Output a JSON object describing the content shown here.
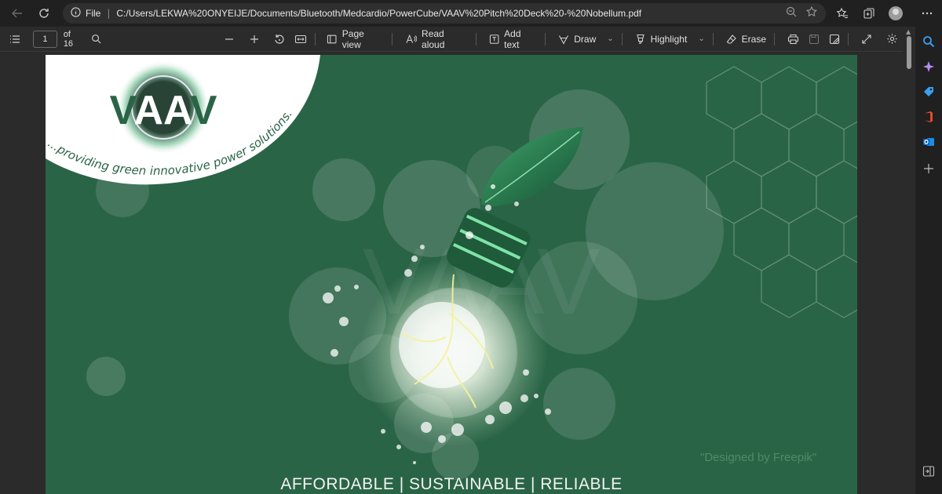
{
  "browser": {
    "file_label": "File",
    "url": "C:/Users/LEKWA%20ONYEIJE/Documents/Bluetooth/Medcardio/PowerCube/VAAV%20Pitch%20Deck%20-%20Nobellum.pdf"
  },
  "pdf_toolbar": {
    "page_number": "1",
    "page_total": "of 16",
    "page_view": "Page view",
    "read_aloud": "Read aloud",
    "add_text": "Add text",
    "draw": "Draw",
    "highlight": "Highlight",
    "erase": "Erase"
  },
  "slide": {
    "logo_text": "VAAV",
    "watermark_text": "VAAV",
    "logo_tagline": "...providing green innovative power solutions.",
    "bottom_tagline": "AFFORDABLE | SUSTAINABLE | RELIABLE",
    "credit": "\"Designed by Freepik\""
  },
  "colors": {
    "slide_background": "#2a6446",
    "logo_green": "#2a6446",
    "browser_chrome": "#202020"
  }
}
